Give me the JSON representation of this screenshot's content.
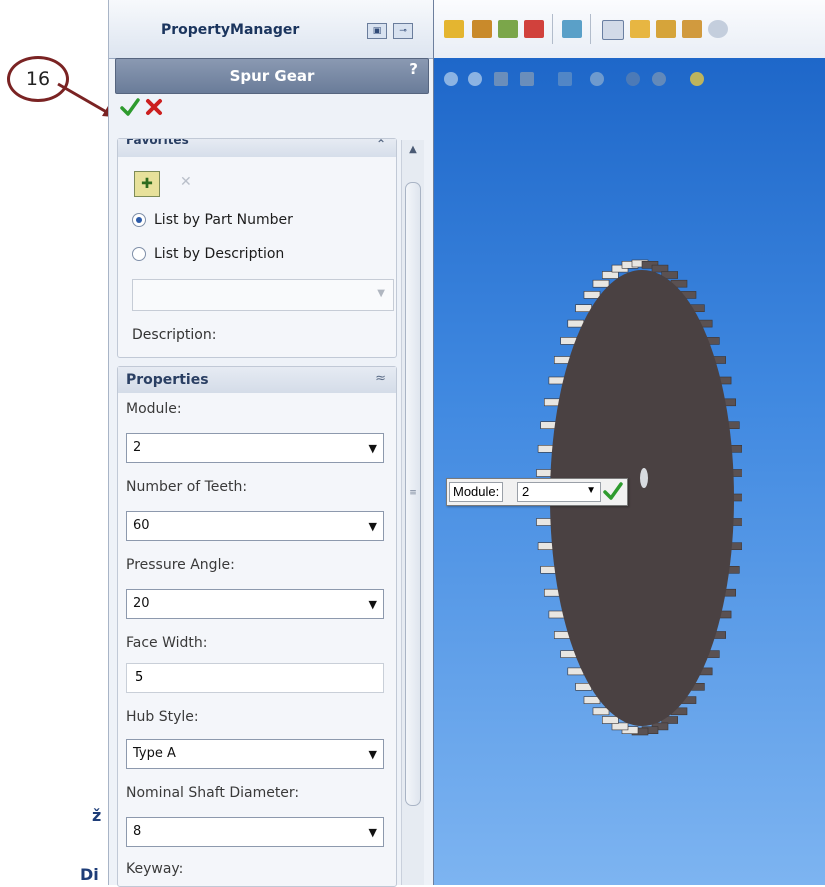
{
  "annotation": {
    "step_number": "16"
  },
  "property_manager": {
    "tab_title": "PropertyManager",
    "feature_title": "Spur Gear",
    "help_label": "?",
    "favorites": {
      "title": "Favorites",
      "options": [
        {
          "label": "List by Part Number",
          "selected": true
        },
        {
          "label": "List by Description",
          "selected": false
        }
      ],
      "select_value": "",
      "description_label": "Description:"
    },
    "properties": {
      "title": "Properties",
      "fields": {
        "module": {
          "label": "Module:",
          "value": "2"
        },
        "teeth": {
          "label": "Number of Teeth:",
          "value": "60"
        },
        "pressure_angle": {
          "label": "Pressure Angle:",
          "value": "20"
        },
        "face_width": {
          "label": "Face Width:",
          "value": "5"
        },
        "hub_style": {
          "label": "Hub Style:",
          "value": "Type A"
        },
        "shaft_diameter": {
          "label": "Nominal Shaft Diameter:",
          "value": "8"
        },
        "keyway": {
          "label": "Keyway:"
        }
      }
    }
  },
  "left_fragment": {
    "text": "Di"
  },
  "viewport": {
    "module_callout": {
      "label": "Module:",
      "value": "2"
    }
  },
  "colors": {
    "accent_ok": "#2e9b2e",
    "accent_cancel": "#cc1f1f",
    "viewport_top": "#1e67c9",
    "viewport_bottom": "#7db4f1",
    "gear_face": "#4a4142"
  }
}
